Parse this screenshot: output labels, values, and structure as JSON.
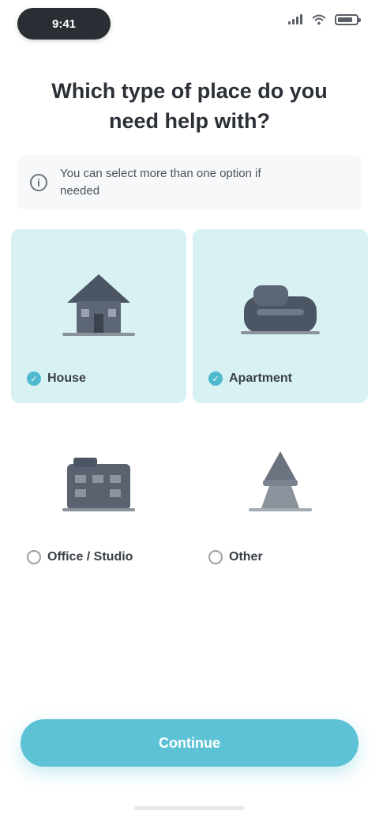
{
  "status_bar": {
    "time": "9:41"
  },
  "header": {
    "title": "Which type of place do you need help with?"
  },
  "info": {
    "icon": "info-icon",
    "text": "You can select more than one option if needed"
  },
  "options": [
    {
      "label": "House",
      "icon": "house-icon",
      "selected": true
    },
    {
      "label": "Apartment",
      "icon": "apartment-icon",
      "selected": true
    },
    {
      "label": "Office / Studio",
      "icon": "office-icon",
      "selected": false
    },
    {
      "label": "Other",
      "icon": "other-place-icon",
      "selected": false
    }
  ],
  "footer": {
    "continue_label": "Continue"
  },
  "colors": {
    "accent": "#5ec2d6",
    "selected_card": "#d8f2f4",
    "text": "#2b2f36"
  }
}
